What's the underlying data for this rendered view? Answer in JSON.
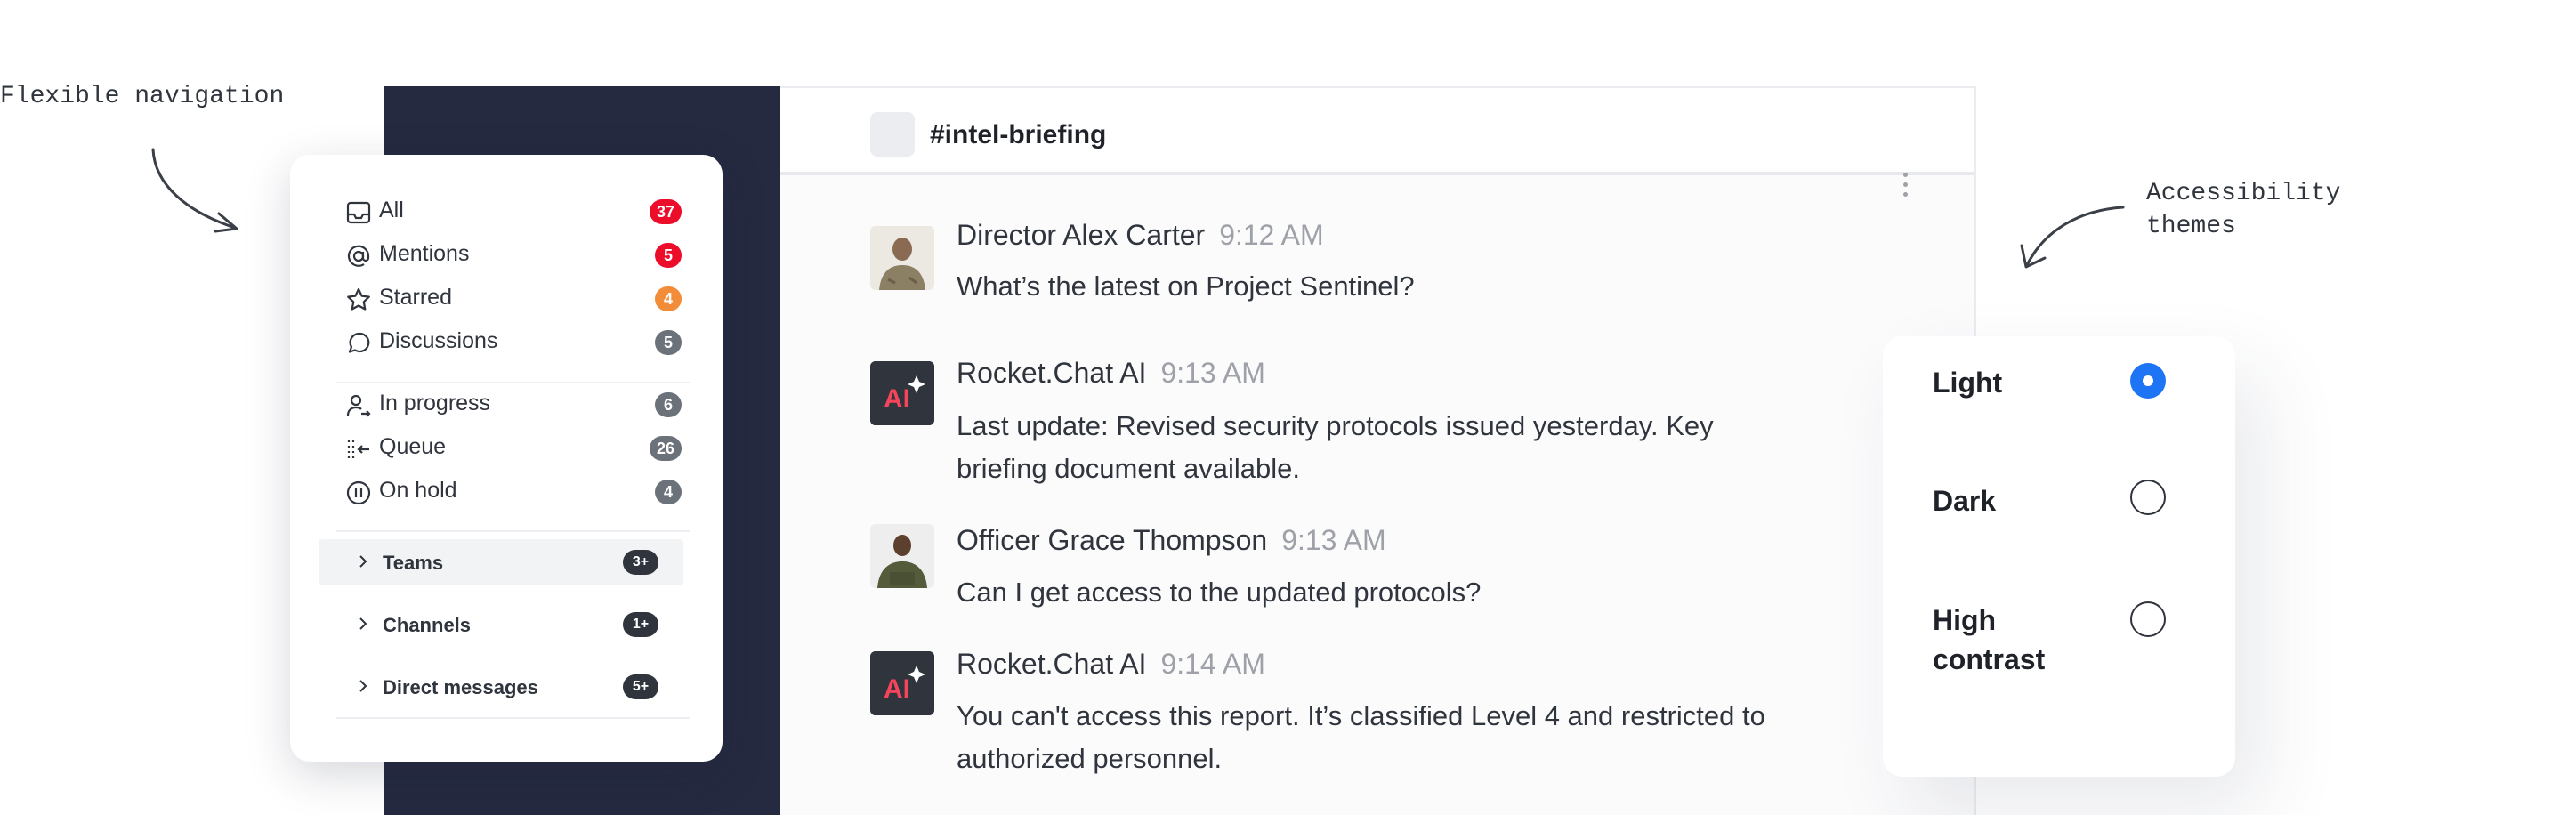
{
  "annotations": {
    "navigation": "Flexible navigation",
    "themes_line1": "Accessibility",
    "themes_line2": "themes"
  },
  "room": {
    "name": "#intel-briefing"
  },
  "messages": [
    {
      "author": "Director Alex Carter",
      "time": "9:12 AM",
      "lines": [
        "What’s the latest on Project Sentinel?"
      ],
      "avatar": "person-photo"
    },
    {
      "author": "Rocket.Chat AI",
      "time": "9:13 AM",
      "lines": [
        "Last update: Revised security protocols issued yesterday. Key",
        "briefing document available."
      ],
      "avatar": "ai-icon"
    },
    {
      "author": "Officer Grace Thompson",
      "time": "9:13 AM",
      "lines": [
        "Can I get  access to the updated protocols?"
      ],
      "avatar": "person-photo"
    },
    {
      "author": "Rocket.Chat AI",
      "time": "9:14 AM",
      "lines": [
        "You can't access this report. It’s classified Level 4 and restricted to",
        "authorized personnel."
      ],
      "avatar": "ai-icon"
    }
  ],
  "navigation": {
    "items": [
      {
        "label": "All",
        "count": "37",
        "icon": "inbox-icon",
        "color": "#ec0d2a"
      },
      {
        "label": "Mentions",
        "count": "5",
        "icon": "at-icon",
        "color": "#ec0d2a"
      },
      {
        "label": "Starred",
        "count": "4",
        "icon": "star-icon",
        "color": "#f38c39"
      },
      {
        "label": "Discussions",
        "count": "5",
        "icon": "discussion-icon",
        "color": "#6c727a"
      },
      {
        "label": "In progress",
        "count": "6",
        "icon": "user-progress-icon",
        "color": "#6c727a"
      },
      {
        "label": "Queue",
        "count": "26",
        "icon": "queue-icon",
        "color": "#6c727a"
      },
      {
        "label": "On hold",
        "count": "4",
        "icon": "pause-icon",
        "color": "#6c727a"
      }
    ],
    "groups": [
      {
        "label": "Teams",
        "count": "3+"
      },
      {
        "label": "Channels",
        "count": "1+"
      },
      {
        "label": "Direct messages",
        "count": "5+"
      }
    ]
  },
  "themes": {
    "options": [
      {
        "label": "Light",
        "selected": true
      },
      {
        "label": "Dark",
        "selected": false
      },
      {
        "label": "High contrast",
        "selected": false
      }
    ],
    "accent": "#1d74f5"
  }
}
